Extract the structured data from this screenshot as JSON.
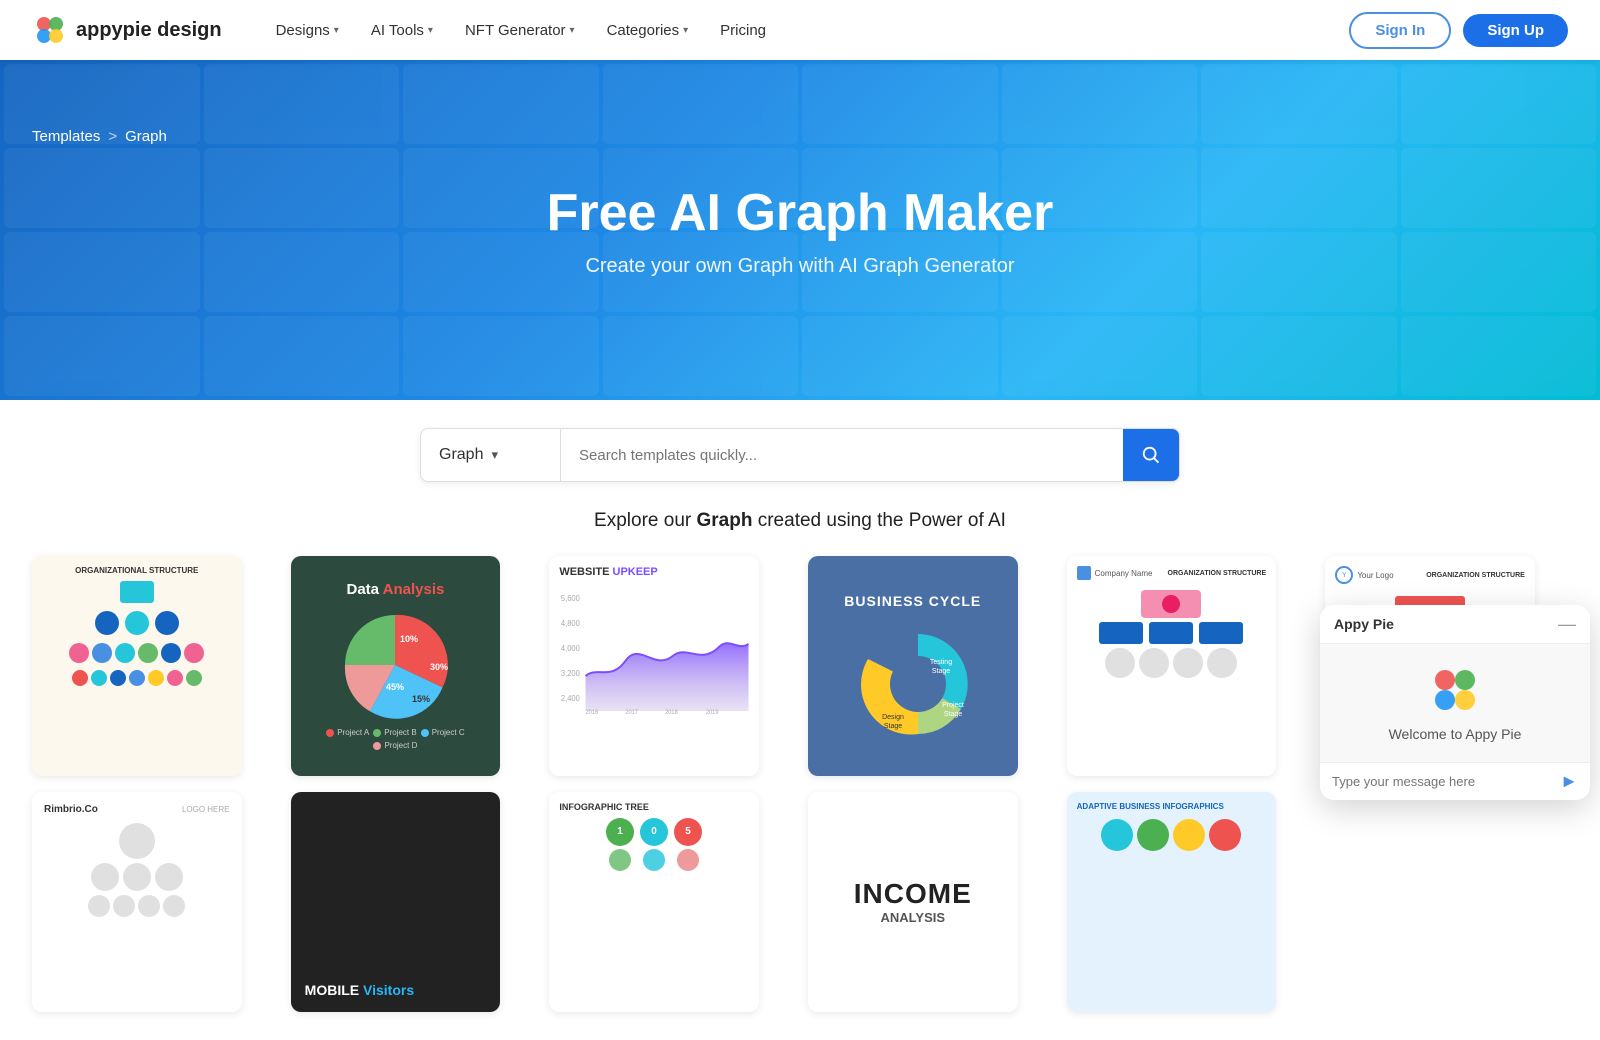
{
  "navbar": {
    "logo_text": "appypie design",
    "nav_items": [
      {
        "label": "Designs",
        "has_dropdown": true
      },
      {
        "label": "AI Tools",
        "has_dropdown": true
      },
      {
        "label": "NFT Generator",
        "has_dropdown": true
      },
      {
        "label": "Categories",
        "has_dropdown": true
      },
      {
        "label": "Pricing",
        "has_dropdown": false
      }
    ],
    "signin_label": "Sign In",
    "signup_label": "Sign Up"
  },
  "breadcrumb": {
    "templates_label": "Templates",
    "separator": ">",
    "current_label": "Graph"
  },
  "hero": {
    "title": "Free AI Graph Maker",
    "subtitle": "Create your own Graph with AI Graph Generator"
  },
  "search": {
    "dropdown_label": "Graph",
    "placeholder": "Search templates quickly..."
  },
  "explore": {
    "title_prefix": "Explore our ",
    "title_bold": "Graph",
    "title_suffix": " created using the Power of AI"
  },
  "templates": [
    {
      "id": 1,
      "type": "org-structure",
      "title": "ORGANIZATIONAL STRUCTURE"
    },
    {
      "id": 2,
      "type": "data-analysis",
      "title": "Data",
      "title2": "Analysis",
      "segments": [
        {
          "label": "30%",
          "color": "#4fc3f7",
          "value": 30
        },
        {
          "label": "10%",
          "color": "#66bb6a",
          "value": 10
        },
        {
          "label": "15%",
          "color": "#ef9a9a",
          "value": 15
        },
        {
          "label": "45%",
          "color": "#ef5350",
          "value": 45
        }
      ],
      "legend": [
        {
          "label": "Project A",
          "color": "#ef5350"
        },
        {
          "label": "Project B",
          "color": "#66bb6a"
        },
        {
          "label": "Project C",
          "color": "#4fc3f7"
        },
        {
          "label": "Project D",
          "color": "#ef9a9a"
        }
      ]
    },
    {
      "id": 3,
      "type": "website-upkeep",
      "title": "WEBSITE",
      "title2": "UPKEEP"
    },
    {
      "id": 4,
      "type": "business-cycle",
      "title": "BUSINESS CYCLE",
      "segments": [
        {
          "label": "Project Stage",
          "color": "#26c6da",
          "value": 30
        },
        {
          "label": "Testing Stage",
          "color": "#aed581",
          "value": 25
        },
        {
          "label": "Design Stage",
          "color": "#ffca28",
          "value": 45
        }
      ]
    },
    {
      "id": 5,
      "type": "org-structure-2",
      "title": "ORGANIZATION STRUCTURE"
    },
    {
      "id": 6,
      "type": "org-structure-3",
      "title": "ORGANIZATION STRUCTURE"
    },
    {
      "id": 7,
      "type": "rimbrio",
      "title": "Rimbrio.Co"
    },
    {
      "id": 8,
      "type": "mobile-visitors",
      "title": "MOBILE",
      "title2": "Visitors"
    },
    {
      "id": 9,
      "type": "infographic-tree",
      "title": "INFOGRAPHIC TREE"
    },
    {
      "id": 10,
      "type": "income-analysis",
      "title": "INCOME",
      "subtitle": "ANALYSIS"
    },
    {
      "id": 11,
      "type": "adaptive-business",
      "title": "ADAPTIVE BUSINESS INFOGRAPHICS"
    }
  ],
  "chat": {
    "header_title": "Appy Pie",
    "welcome_text": "Welcome to Appy Pie",
    "input_placeholder": "Type your message here"
  },
  "colors": {
    "primary": "#1d6fe8",
    "secondary": "#29b6f6",
    "accent": "#ef5350"
  }
}
